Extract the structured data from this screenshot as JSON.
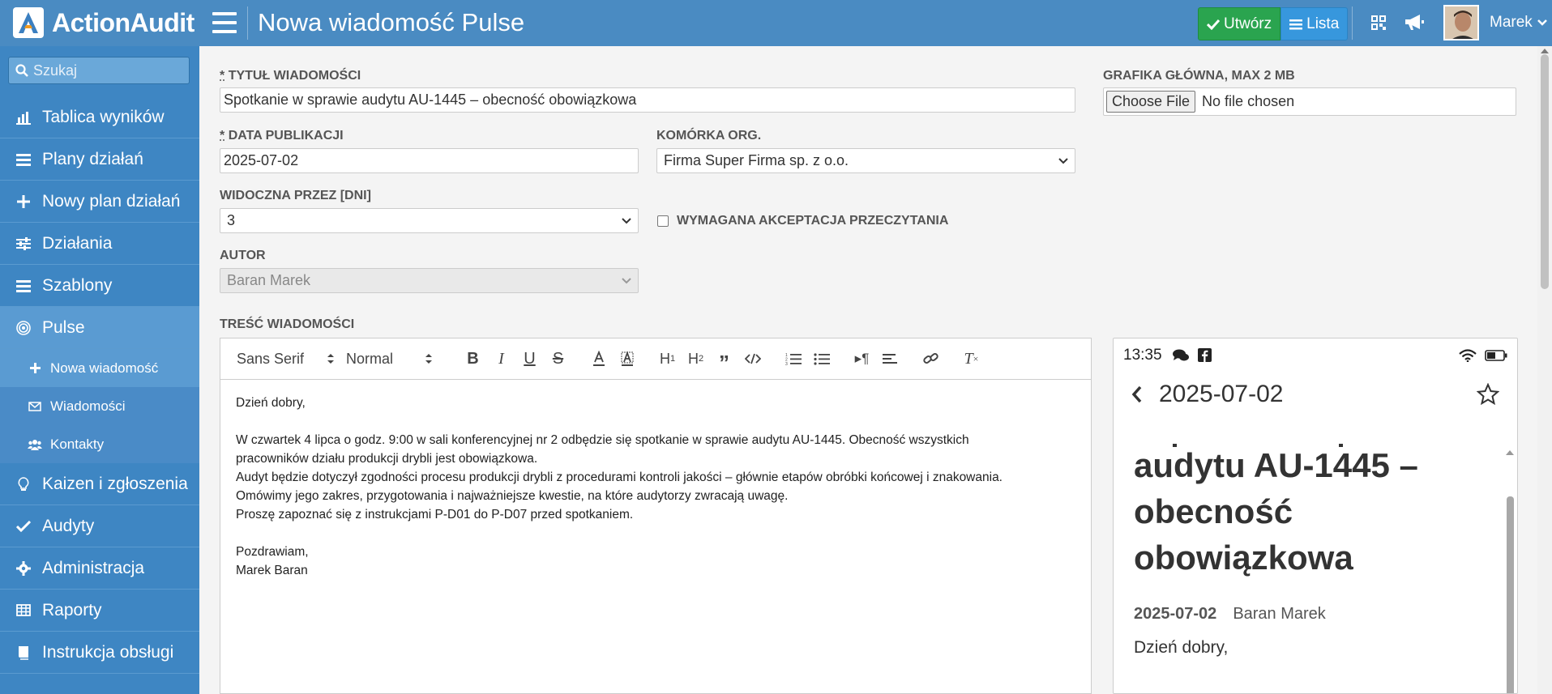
{
  "header": {
    "brand": "ActionAudit",
    "title": "Nowa wiadomość Pulse",
    "create_label": "Utwórz",
    "list_label": "Lista",
    "user_name": "Marek",
    "icons": [
      "qrcode-icon",
      "megaphone-icon",
      "hamburger-icon"
    ]
  },
  "sidebar": {
    "search_placeholder": "Szukaj",
    "items": [
      {
        "label": "Tablica wyników",
        "icon": "dashboard-icon"
      },
      {
        "label": "Plany działań",
        "icon": "list-icon"
      },
      {
        "label": "Nowy plan działań",
        "icon": "plus-icon"
      },
      {
        "label": "Działania",
        "icon": "sliders-icon"
      },
      {
        "label": "Szablony",
        "icon": "list-icon"
      },
      {
        "label": "Pulse",
        "icon": "pulse-icon"
      },
      {
        "label": "Kaizen i zgłoszenia",
        "icon": "lightbulb-icon"
      },
      {
        "label": "Audyty",
        "icon": "check-icon"
      },
      {
        "label": "Administracja",
        "icon": "gear-icon"
      },
      {
        "label": "Raporty",
        "icon": "table-icon"
      },
      {
        "label": "Instrukcja obsługi",
        "icon": "book-icon"
      }
    ],
    "sub_items": [
      {
        "label": "Nowa wiadomość",
        "icon": "plus-icon"
      },
      {
        "label": "Wiadomości",
        "icon": "envelope-icon"
      },
      {
        "label": "Kontakty",
        "icon": "users-icon"
      }
    ]
  },
  "form": {
    "title_label": "Tytuł wiadomości",
    "title_value": "Spotkanie w sprawie audytu AU-1445 – obecność obowiązkowa",
    "image_label": "Grafika główna, max 2 MB",
    "file_button": "Choose File",
    "file_status": "No file chosen",
    "date_label": "Data publikacji",
    "date_value": "2025-07-02",
    "unit_label": "Komórka org.",
    "unit_value": "Firma Super Firma sp. z o.o.",
    "visible_label": "Widoczna przez [dni]",
    "visible_value": "3",
    "ack_label": "Wymagana akceptacja przeczytania",
    "author_label": "Autor",
    "author_value": "Baran Marek",
    "content_label": "Treść wiadomości",
    "required_mark": "*"
  },
  "editor": {
    "font": "Sans Serif",
    "size": "Normal",
    "lines": [
      "Dzień dobry,",
      "",
      "W czwartek 4 lipca o godz. 9:00 w sali konferencyjnej nr 2 odbędzie się spotkanie w sprawie audytu AU-1445. Obecność wszystkich",
      "pracowników działu produkcji drybli jest obowiązkowa.",
      "Audyt będzie dotyczył zgodności procesu produkcji drybli z procedurami kontroli jakości – głównie etapów obróbki końcowej i znakowania.",
      "Omówimy jego zakres, przygotowania i najważniejsze kwestie, na które audytorzy zwracają uwagę.",
      "Proszę zapoznać się z instrukcjami P-D01 do P-D07 przed spotkaniem.",
      "",
      "Pozdrawiam,",
      "Marek Baran"
    ]
  },
  "preview": {
    "time": "13:35",
    "date": "2025-07-02",
    "title_lines": [
      "audytu AU-1445 –",
      "obecność",
      "obowiązkowa"
    ],
    "meta_date": "2025-07-02",
    "meta_author": "Baran Marek",
    "body_first": "Dzień dobry,"
  }
}
